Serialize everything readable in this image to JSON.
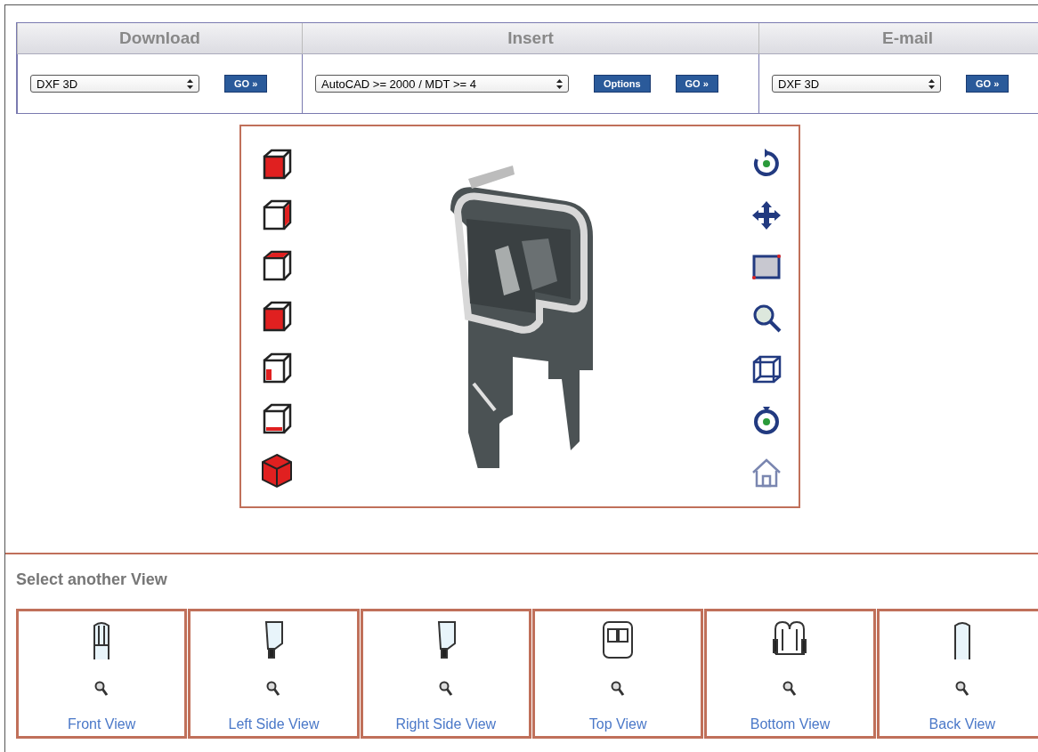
{
  "actions": [
    {
      "title": "Download",
      "select": "DXF 3D",
      "buttons": [
        "GO »"
      ]
    },
    {
      "title": "Insert",
      "select": "AutoCAD >= 2000 / MDT >= 4",
      "buttons": [
        "Options",
        "GO »"
      ]
    },
    {
      "title": "E-mail",
      "select": "DXF 3D",
      "buttons": [
        "GO »"
      ]
    }
  ],
  "views_title": "Select another View",
  "views": [
    {
      "label": "Front View"
    },
    {
      "label": "Left Side View"
    },
    {
      "label": "Right Side View"
    },
    {
      "label": "Top View"
    },
    {
      "label": "Bottom View"
    },
    {
      "label": "Back View"
    }
  ]
}
